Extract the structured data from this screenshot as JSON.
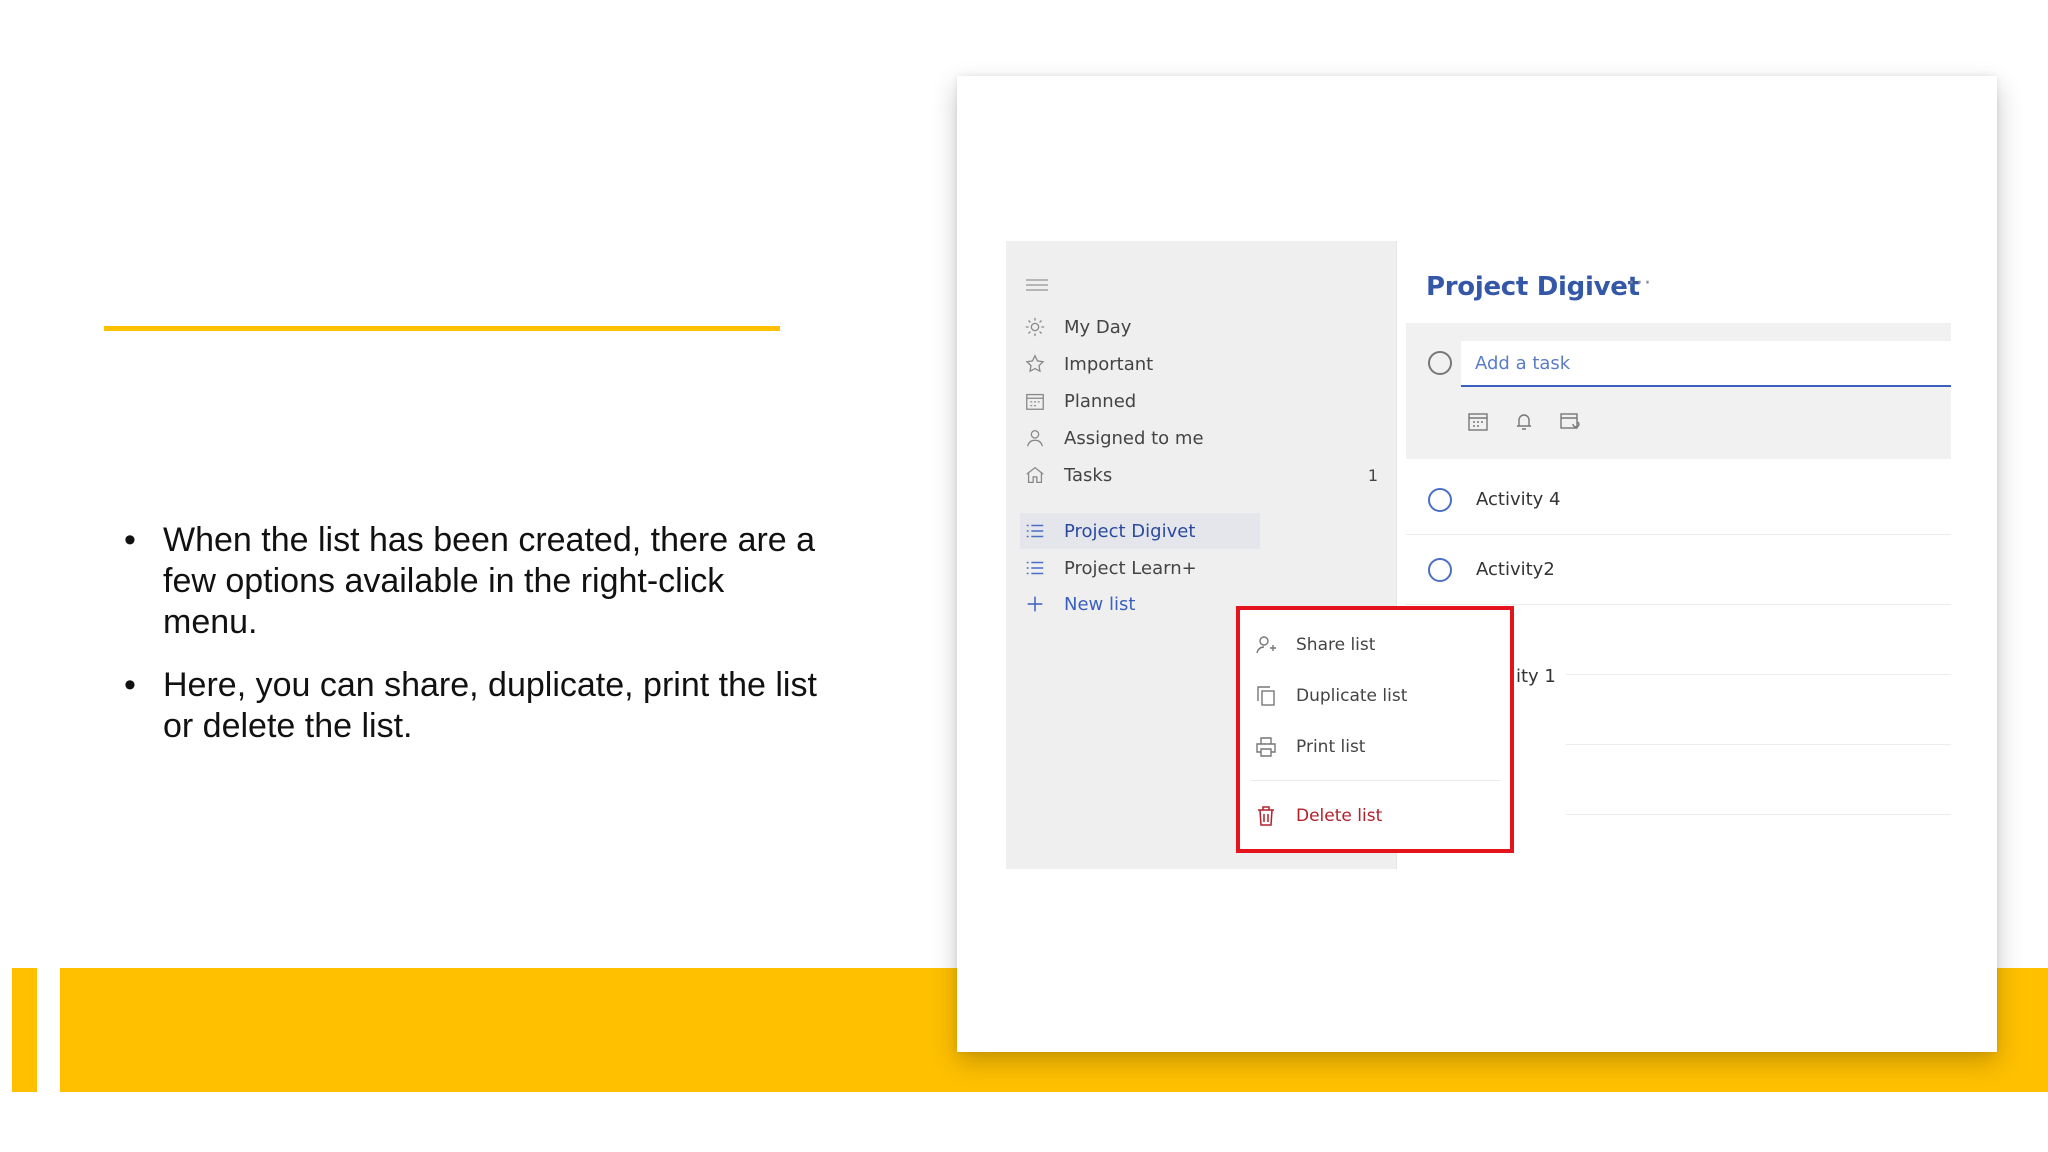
{
  "slide": {
    "bullets": [
      "When the list has been created, there are a few options available in the right-click menu.",
      "Here, you can  share,  duplicate, print the list or delete the list."
    ],
    "accent_color": "#ffc000"
  },
  "sidebar": {
    "items": [
      {
        "label": "My Day",
        "icon": "sun-icon"
      },
      {
        "label": "Important",
        "icon": "star-icon"
      },
      {
        "label": "Planned",
        "icon": "calendar-icon"
      },
      {
        "label": "Assigned to me",
        "icon": "person-icon"
      },
      {
        "label": "Tasks",
        "icon": "home-icon",
        "count": "1"
      },
      {
        "label": "Project Digivet",
        "icon": "list-icon"
      },
      {
        "label": "Project Learn+",
        "icon": "list-icon"
      },
      {
        "label": "New list",
        "icon": "plus-icon"
      }
    ]
  },
  "main": {
    "title": "Project Digivet",
    "more": "···",
    "add_task_placeholder": "Add a task",
    "tasks": [
      "Activity 4",
      "Activity2",
      "ity 1"
    ]
  },
  "context_menu": {
    "items": [
      {
        "label": "Share list",
        "icon": "share-person-icon"
      },
      {
        "label": "Duplicate list",
        "icon": "duplicate-icon"
      },
      {
        "label": "Print list",
        "icon": "printer-icon"
      },
      {
        "label": "Delete list",
        "icon": "trash-icon"
      }
    ],
    "highlight_color": "#e3141b"
  }
}
